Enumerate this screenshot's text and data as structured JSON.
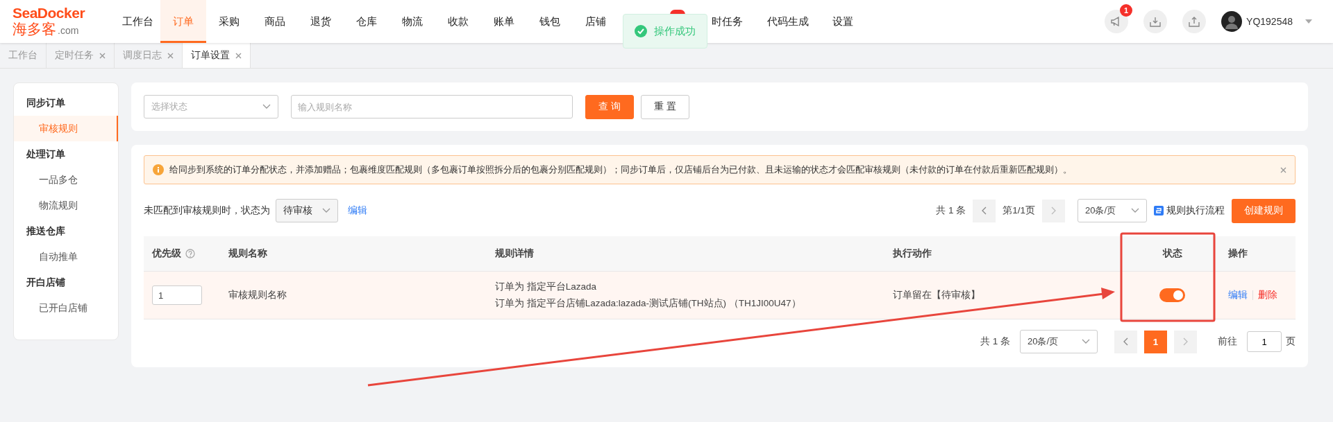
{
  "logo": {
    "brand": "SeaDocker",
    "cn": "海多客",
    "domain": ".com"
  },
  "nav": [
    {
      "label": "工作台",
      "selected": false
    },
    {
      "label": "订单",
      "selected": true
    },
    {
      "label": "采购",
      "selected": false
    },
    {
      "label": "商品",
      "selected": false
    },
    {
      "label": "退货",
      "selected": false
    },
    {
      "label": "仓库",
      "selected": false
    },
    {
      "label": "物流",
      "selected": false
    },
    {
      "label": "收款",
      "selected": false
    },
    {
      "label": "账单",
      "selected": false
    },
    {
      "label": "钱包",
      "selected": false
    },
    {
      "label": "店铺",
      "selected": false
    },
    {
      "label": "时任务",
      "selected": false,
      "badge": true
    },
    {
      "label": "代码生成",
      "selected": false
    },
    {
      "label": "设置",
      "selected": false
    }
  ],
  "toast": {
    "text": "操作成功"
  },
  "header_actions": [
    {
      "kind": "megaphone",
      "badge": "1"
    },
    {
      "kind": "download"
    },
    {
      "kind": "upload"
    }
  ],
  "user": {
    "name": "YQ192548"
  },
  "tabs": [
    {
      "label": "工作台",
      "selected": false,
      "closable": false
    },
    {
      "label": "定时任务",
      "selected": false,
      "closable": true
    },
    {
      "label": "调度日志",
      "selected": false,
      "closable": true
    },
    {
      "label": "订单设置",
      "selected": true,
      "closable": true
    }
  ],
  "sidebar": [
    {
      "label": "同步订单",
      "children": [
        {
          "label": "审核规则",
          "selected": true
        }
      ]
    },
    {
      "label": "处理订单",
      "children": [
        {
          "label": "一品多仓",
          "selected": false
        },
        {
          "label": "物流规则",
          "selected": false
        }
      ]
    },
    {
      "label": "推送仓库",
      "children": [
        {
          "label": "自动推单",
          "selected": false
        }
      ]
    },
    {
      "label": "开白店铺",
      "children": [
        {
          "label": "已开白店铺",
          "selected": false
        }
      ]
    }
  ],
  "filter": {
    "status_placeholder": "选择状态",
    "name_placeholder": "输入规则名称",
    "buttons": [
      {
        "label": "查 询",
        "kind": "primary"
      },
      {
        "label": "重 置",
        "kind": "default"
      }
    ]
  },
  "alert": {
    "text": "给同步到系统的订单分配状态，并添加赠品；包裹维度匹配规则（多包裹订单按照拆分后的包裹分别匹配规则）；同步订单后，仅店铺后台为已付款、且未运输的状态才会匹配审核规则（未付款的订单在付款后重新匹配规则）。"
  },
  "default_status": {
    "label": "未匹配到审核规则时，状态为",
    "value": "待审核",
    "edit": "编辑"
  },
  "top_pagination": {
    "total": "共 1 条",
    "page": "第1/1页",
    "page_size": "20条/页"
  },
  "flow_link": "规则执行流程",
  "create_button": "创建规则",
  "table": {
    "columns": [
      "优先级",
      "规则名称",
      "规则详情",
      "执行动作",
      "状态",
      "操作"
    ],
    "rows": [
      {
        "priority": "1",
        "name": "审核规则名称",
        "details": [
          "订单为 指定平台Lazada",
          "订单为 指定平台店铺Lazada:lazada-测试店铺(TH站点) （TH1JI00U47）"
        ],
        "action": "订单留在【待审核】",
        "on": true,
        "edit": "编辑",
        "delete": "删除"
      }
    ]
  },
  "pagination": {
    "total": "共 1 条",
    "page_size": "20条/页",
    "pages": [
      {
        "label": "1",
        "selected": true
      }
    ],
    "goto_label": "前往",
    "goto_value": "1",
    "goto_suffix": "页"
  },
  "annotations": {
    "highlight_box": true,
    "arrow": true
  }
}
